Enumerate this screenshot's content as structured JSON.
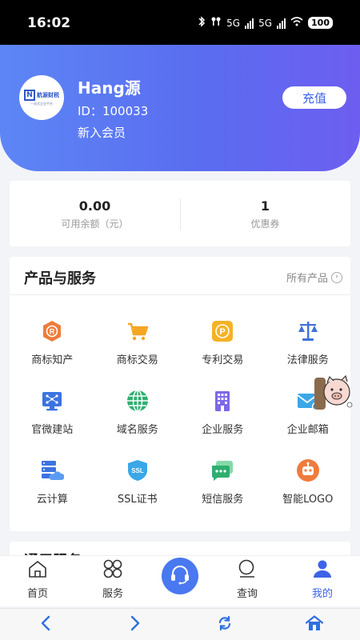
{
  "status_bar": {
    "time": "16:02",
    "network_1": "5G",
    "network_2": "5G",
    "battery": "100"
  },
  "profile": {
    "avatar": {
      "brand": "航源财税",
      "slogan": "一站式企业平台"
    },
    "name": "Hang源",
    "id_text": "ID：100033",
    "level": "新入会员",
    "recharge_label": "充值"
  },
  "balance": {
    "available_value": "0.00",
    "available_label": "可用余额（元）",
    "coupon_value": "1",
    "coupon_label": "优惠券"
  },
  "services": {
    "title": "产品与服务",
    "all_products_label": "所有产品",
    "items": [
      {
        "label": "商标知产",
        "icon": "trademark-icon",
        "color": "#ef7b3b"
      },
      {
        "label": "商标交易",
        "icon": "shopping-cart-icon",
        "color": "#f5a623"
      },
      {
        "label": "专利交易",
        "icon": "patent-icon",
        "color": "#f5b223"
      },
      {
        "label": "法律服务",
        "icon": "scales-icon",
        "color": "#3f72d8"
      },
      {
        "label": "官微建站",
        "icon": "website-builder-icon",
        "color": "#3b73e0"
      },
      {
        "label": "域名服务",
        "icon": "globe-icon",
        "color": "#2fae6f"
      },
      {
        "label": "企业服务",
        "icon": "building-icon",
        "color": "#7d68e8"
      },
      {
        "label": "企业邮箱",
        "icon": "mail-icon",
        "color": "#3aa7e8"
      },
      {
        "label": "云计算",
        "icon": "cloud-server-icon",
        "color": "#3b73e0"
      },
      {
        "label": "SSL证书",
        "icon": "ssl-certificate-icon",
        "color": "#3aa7e8"
      },
      {
        "label": "短信服务",
        "icon": "sms-icon",
        "color": "#2fae6f"
      },
      {
        "label": "智能LOGO",
        "icon": "robot-icon",
        "color": "#ef7b3b"
      }
    ]
  },
  "next_section": {
    "title": "通用服务"
  },
  "tabbar": {
    "home": "首页",
    "services": "服务",
    "query": "查询",
    "mine": "我的",
    "active_color": "#3d63e8"
  }
}
